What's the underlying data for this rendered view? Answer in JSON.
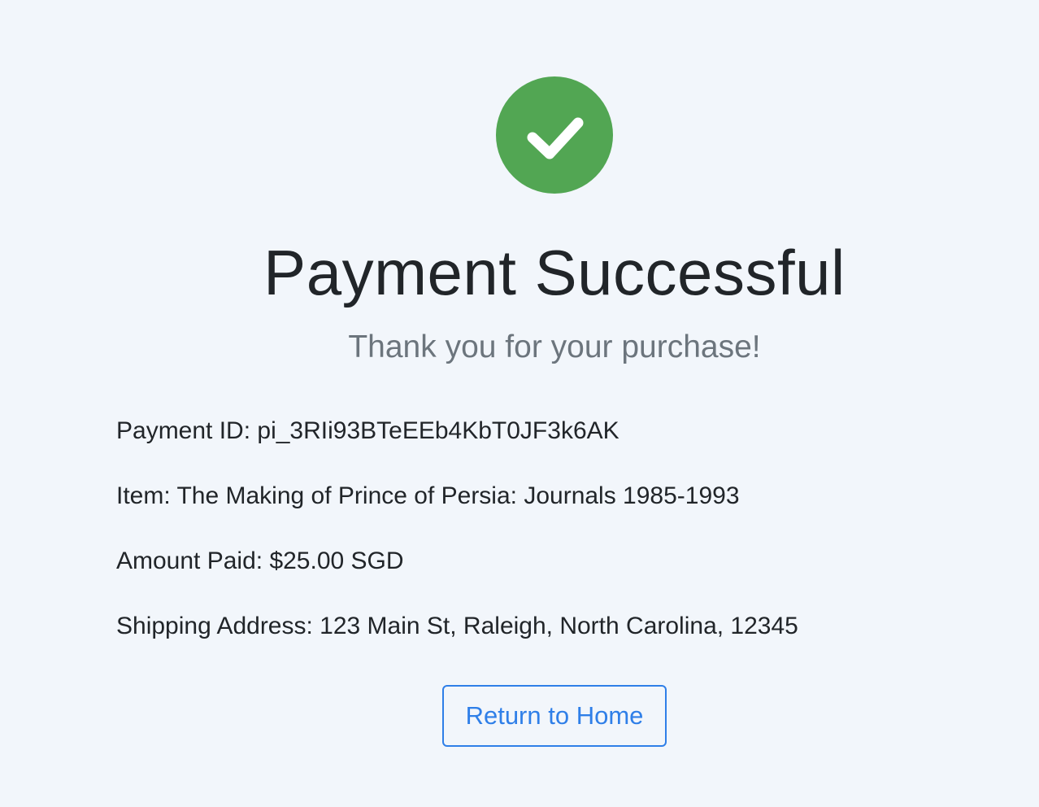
{
  "status_icon": {
    "name": "check-circle-icon",
    "color": "#52a653"
  },
  "title": "Payment Successful",
  "subtitle": "Thank you for your purchase!",
  "details": {
    "payment_id": "Payment ID: pi_3RIi93BTeEEb4KbT0JF3k6AK",
    "item": "Item: The Making of Prince of Persia: Journals 1985-1993",
    "amount_paid": "Amount Paid: $25.00 SGD",
    "shipping_address": "Shipping Address: 123 Main St, Raleigh, North Carolina, 12345"
  },
  "return_button": {
    "label": "Return to Home",
    "color": "#2f7fe8"
  }
}
